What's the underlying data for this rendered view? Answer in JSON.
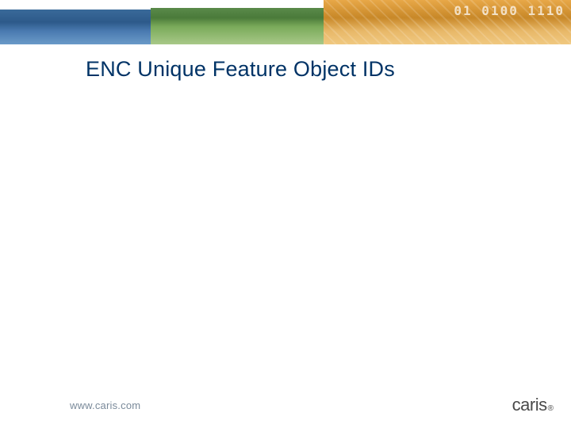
{
  "header": {
    "digits_overlay": "01 0100 1110"
  },
  "slide": {
    "title": "ENC Unique Feature Object IDs"
  },
  "footer": {
    "url": "www.caris.com",
    "logo_text": "caris",
    "logo_mark": "®"
  }
}
